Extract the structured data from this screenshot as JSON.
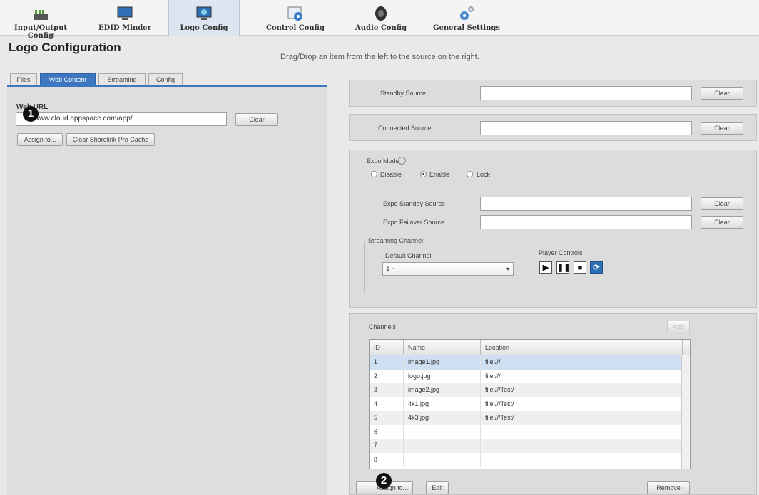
{
  "nav": {
    "items": [
      {
        "label": "Input/Output Config",
        "icon": "input-output-icon"
      },
      {
        "label": "EDID Minder",
        "icon": "monitor-icon"
      },
      {
        "label": "Logo Config",
        "icon": "logo-config-icon"
      },
      {
        "label": "Control Config",
        "icon": "control-config-icon"
      },
      {
        "label": "Audio Config",
        "icon": "speaker-icon"
      },
      {
        "label": "General Settings",
        "icon": "gears-icon"
      }
    ],
    "active": "Logo Config"
  },
  "page": {
    "title": "Logo Configuration",
    "instruction": "Drag/Drop an item from the left to the source on the right."
  },
  "left": {
    "tabs": [
      "Files",
      "Web Content",
      "Streaming",
      "Config"
    ],
    "active_tab": "Web Content",
    "web_url_label": "Web URL",
    "web_url_value": "/www.cloud.appspace.com/app/",
    "clear_label": "Clear",
    "assign_label": "Assign to...",
    "clear_cache_label": "Clear Sharelink Pro Cache",
    "callout": "1"
  },
  "sources": {
    "standby_label": "Standby Source",
    "connected_label": "Connected Source",
    "clear_label": "Clear"
  },
  "expo": {
    "label": "Expo Mode",
    "info_icon": "info-icon",
    "options": [
      "Disable",
      "Enable",
      "Lock"
    ],
    "selected": "Enable",
    "standby_label": "Expo Standby Source",
    "failover_label": "Expo Failover Source",
    "clear_label": "Clear"
  },
  "streaming": {
    "legend": "Streaming Channel",
    "default_channel_label": "Default Channel",
    "default_channel_value": "1 -",
    "player_controls_label": "Player Controls",
    "controls": [
      "play-icon",
      "pause-icon",
      "stop-icon",
      "refresh-icon"
    ]
  },
  "channels": {
    "label": "Channels",
    "add_label": "Add",
    "columns": [
      "ID",
      "Name",
      "Location"
    ],
    "rows": [
      {
        "id": "1",
        "name": "image1.jpg",
        "location": "file:///"
      },
      {
        "id": "2",
        "name": "logo.jpg",
        "location": "file:///"
      },
      {
        "id": "3",
        "name": "image2.jpg",
        "location": "file:///Test/"
      },
      {
        "id": "4",
        "name": "4k1.jpg",
        "location": "file:///Test/"
      },
      {
        "id": "5",
        "name": "4k3.jpg",
        "location": "file:///Test/"
      },
      {
        "id": "6",
        "name": "",
        "location": ""
      },
      {
        "id": "7",
        "name": "",
        "location": ""
      },
      {
        "id": "8",
        "name": "",
        "location": ""
      }
    ],
    "assign_label": "Assign to...",
    "edit_label": "Edit",
    "remove_label": "Remove",
    "callout": "2"
  },
  "colors": {
    "accent": "#3d77c0",
    "nav_active_bg": "#dde6f0",
    "panel_bg": "#dcdcdc",
    "selected_row": "#cfe0f3"
  }
}
